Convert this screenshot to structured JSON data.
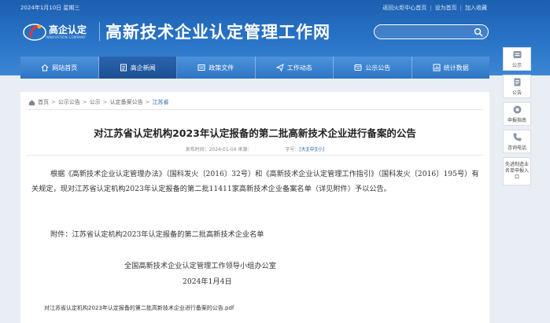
{
  "topbar": {
    "date": "2024年1月10日 星期三",
    "links": [
      "返回火炬中心首页",
      "设为首页",
      "加入收藏"
    ]
  },
  "logo": {
    "text": "高企认定",
    "subtext": "INNOVATION COMPANY"
  },
  "site_title": "高新技术企业认定管理工作网",
  "search": {
    "placeholder": ""
  },
  "nav": {
    "items": [
      {
        "label": "网站首页",
        "icon": "home-icon"
      },
      {
        "label": "高企新闻",
        "icon": "news-icon"
      },
      {
        "label": "政策文件",
        "icon": "document-icon"
      },
      {
        "label": "工作动态",
        "icon": "send-icon"
      },
      {
        "label": "公示公告",
        "icon": "notice-icon"
      },
      {
        "label": "统计数据",
        "icon": "stats-icon"
      }
    ],
    "active_index": 1
  },
  "breadcrumb": [
    "首页",
    "公示公告",
    "公示",
    "认定备案公告",
    "江苏省"
  ],
  "article": {
    "title": "对江苏省认定机构2023年认定报备的第二批高新技术企业进行备案的公告",
    "meta_date_label": "发布时间：2024-01-04 来源：",
    "font_size_label": "字号：",
    "font_sizes": [
      "[大]",
      "[中]",
      "[小]"
    ],
    "paragraph": "根据《高新技术企业认定管理办法》（国科发火〔2016〕32号）和《高新技术企业认定管理工作指引》（国科发火〔2016〕195号）有关规定，现对江苏省认定机构2023年认定报备的第二批11411家高新技术企业备案名单（详见附件）予以公告。",
    "attachment_line": "附件：江苏省认定机构2023年认定报备的第二批高新技术企业名单",
    "sign_org": "全国高新技术企业认定管理工作领导小组办公室",
    "sign_date": "2024年1月4日",
    "pdf_link": "对江苏省认定机构2023年认定报备的第二批高新技术企业进行备案的公告.pdf"
  },
  "rightbar": {
    "items": [
      {
        "label": "公示",
        "icon": "notice-board-icon"
      },
      {
        "label": "公告",
        "icon": "announcement-icon"
      },
      {
        "label": "申报指南",
        "icon": "guide-icon"
      },
      {
        "label": "咨询电话",
        "icon": "phone-icon"
      }
    ],
    "report_label": "先进制造业名单申报入口"
  },
  "colors": {
    "header_blue": "#2a74c8",
    "nav_active": "#1c4f93",
    "link_blue": "#2060b0"
  }
}
